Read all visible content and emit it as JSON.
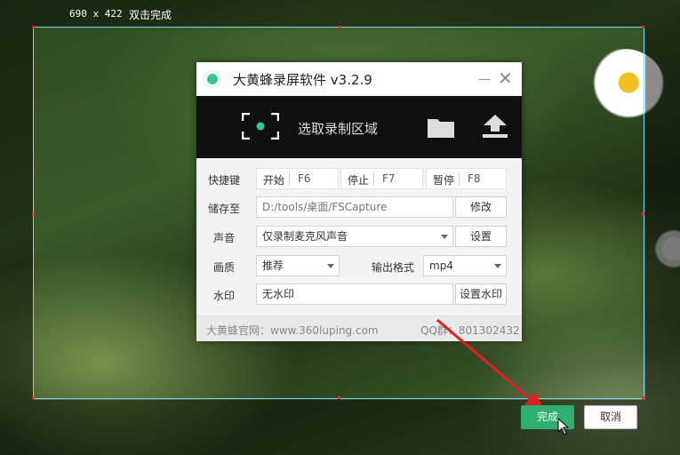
{
  "overlay": {
    "size_text": "690 x 422",
    "hint_text": "双击完成"
  },
  "dialog": {
    "title": "大黄蜂录屏软件 v3.2.9",
    "toolbar": {
      "region_label": "选取录制区域",
      "icons": [
        "region-select-icon",
        "folder-icon",
        "upload-icon"
      ]
    },
    "hotkeys": {
      "label": "快捷键",
      "items": [
        {
          "action": "开始",
          "key": "F6"
        },
        {
          "action": "停止",
          "key": "F7"
        },
        {
          "action": "暂停",
          "key": "F8"
        }
      ]
    },
    "save_to": {
      "label": "储存至",
      "value": "D:/tools/桌面/FSCapture",
      "button": "修改"
    },
    "audio": {
      "label": "声音",
      "value": "仅录制麦克风声音",
      "button": "设置"
    },
    "quality": {
      "label": "画质",
      "value": "推荐",
      "format_label": "输出格式",
      "format_value": "mp4"
    },
    "watermark": {
      "label": "水印",
      "value": "无水印",
      "button": "设置水印"
    },
    "footer": {
      "site": "大黄蜂官网：www.360luping.com",
      "qq": "QQ群：801302432"
    }
  },
  "actions": {
    "done": "完成",
    "cancel": "取消"
  },
  "colors": {
    "accent": "#3cc48f",
    "done_button": "#2fae72",
    "selection_border": "#7fd4e6",
    "annotation_arrow": "#e02020"
  }
}
